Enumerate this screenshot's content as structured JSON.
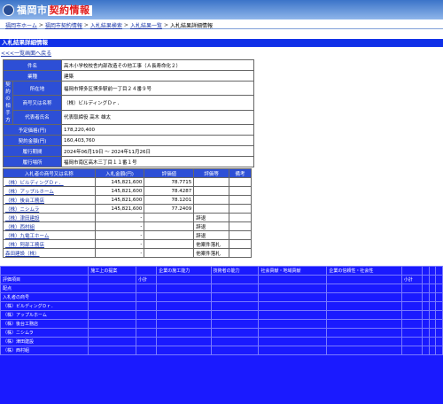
{
  "header": {
    "logo_prefix": "福岡市",
    "logo_highlight": "契約情報"
  },
  "breadcrumb": [
    {
      "label": "福岡市ホーム",
      "link": true
    },
    {
      "label": "福岡市契約情報",
      "link": true
    },
    {
      "label": "入札結果検索",
      "link": true
    },
    {
      "label": "入札結果一覧",
      "link": true
    },
    {
      "label": "入札結果詳細情報",
      "link": false
    }
  ],
  "page_title": "入札結果詳細情報",
  "back_link": "<<<一覧画面へ戻る",
  "info": {
    "group_label": "契約の相手方",
    "rows": [
      {
        "label": "件名",
        "value": "高木小学校校舎内部改造その他工事（Ａ長寿命化２）"
      },
      {
        "label": "業種",
        "value": "建築"
      },
      {
        "label": "所在地",
        "value": "福岡市博多区博多駅前一丁目２４番９号"
      },
      {
        "label": "商号又は名称",
        "value": "（株）ビルディングＤｒ．"
      },
      {
        "label": "代表者氏名",
        "value": "代表取締役 高木 雄太"
      },
      {
        "label": "予定価格(円)",
        "value": "178,220,400"
      },
      {
        "label": "契約金額(円)",
        "value": "160,403,760"
      },
      {
        "label": "履行期間",
        "value": "2024年06月19日 ～ 2024年11月26日"
      },
      {
        "label": "履行場所",
        "value": "福岡市南区高木三丁目１１番１号"
      }
    ]
  },
  "bids": {
    "headers": [
      "入札者の商号又は名称",
      "入札金額(円)",
      "評価値",
      "評価等",
      "備考"
    ],
    "rows": [
      [
        "（株）ビルディングＤｒ．",
        "145,821,600",
        "78.7715",
        "",
        ""
      ],
      [
        "（株）アップルホーム",
        "145,821,600",
        "78.4287",
        "",
        ""
      ],
      [
        "（株）後台工務店",
        "145,821,600",
        "78.1201",
        "",
        ""
      ],
      [
        "（株）ニシムラ",
        "145,821,600",
        "77.2409",
        "",
        ""
      ],
      [
        "（株）津田建設",
        "-",
        "",
        "辞退",
        ""
      ],
      [
        "（株）西村組",
        "-",
        "",
        "辞退",
        ""
      ],
      [
        "（株）九電工ホーム",
        "-",
        "",
        "辞退",
        ""
      ],
      [
        "（株）阿部工務店",
        "-",
        "",
        "他案件落札",
        ""
      ],
      [
        "森田建設（株）",
        "-",
        "",
        "他案件落札",
        ""
      ]
    ]
  },
  "eval": {
    "rows": [
      [
        "",
        "施工上の提案",
        "",
        "企業の施工能力",
        "技術者の能力",
        "社会貢献・地域貢献",
        "企業の信頼性・社会性",
        "",
        "",
        "",
        ""
      ],
      [
        "評価項目",
        "",
        "小計",
        "",
        "",
        "",
        "",
        "小計",
        "",
        "",
        ""
      ],
      [
        "配点",
        "",
        "",
        "",
        "",
        "",
        "",
        "",
        "",
        "",
        ""
      ],
      [
        "入札者の商号",
        "",
        "",
        "",
        "",
        "",
        "",
        "",
        "",
        "",
        ""
      ],
      [
        "（株）ビルディングＤｒ．",
        "",
        "",
        "",
        "",
        "",
        "",
        "",
        "",
        "",
        ""
      ],
      [
        "（株）アップルホーム",
        "",
        "",
        "",
        "",
        "",
        "",
        "",
        "",
        "",
        ""
      ],
      [
        "（株）後台工務店",
        "",
        "",
        "",
        "",
        "",
        "",
        "",
        "",
        "",
        ""
      ],
      [
        "（株）ニシムラ",
        "",
        "",
        "",
        "",
        "",
        "",
        "",
        "",
        "",
        ""
      ],
      [
        "（株）津田建設",
        "",
        "",
        "",
        "",
        "",
        "",
        "",
        "",
        "",
        ""
      ],
      [
        "（株）西村組",
        "",
        "",
        "",
        "",
        "",
        "",
        "",
        "",
        "",
        ""
      ]
    ]
  }
}
